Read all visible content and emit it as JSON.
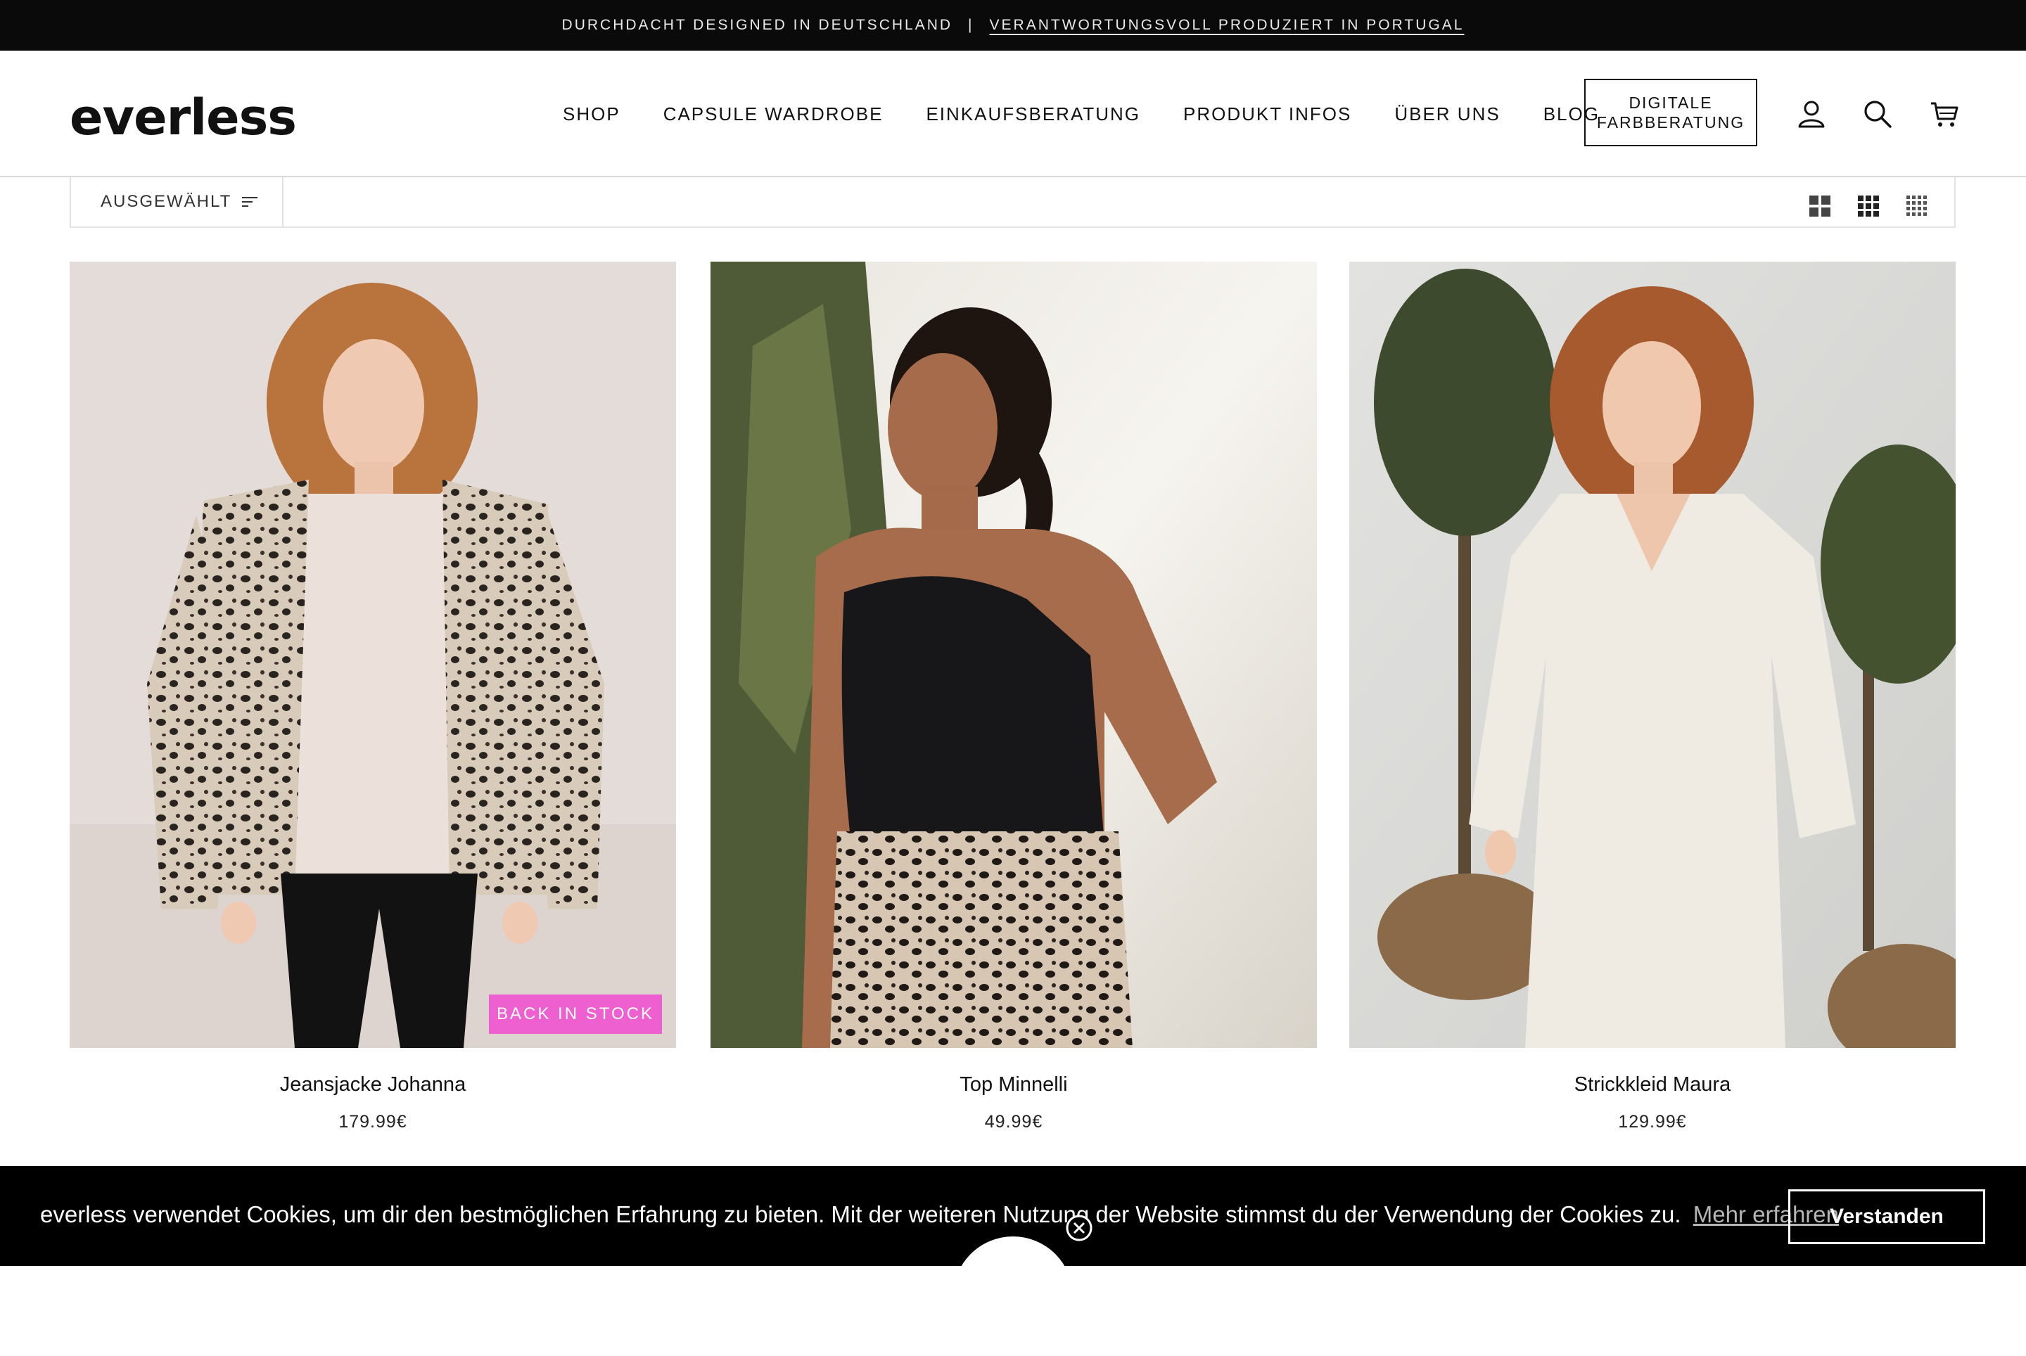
{
  "announcement": {
    "left": "DURCHDACHT DESIGNED IN DEUTSCHLAND",
    "separator": "|",
    "right": "VERANTWORTUNGSVOLL PRODUZIERT IN PORTUGAL"
  },
  "header": {
    "logo": "everless",
    "nav": [
      "SHOP",
      "CAPSULE WARDROBE",
      "EINKAUFSBERATUNG",
      "PRODUKT INFOS",
      "ÜBER UNS",
      "BLOG"
    ],
    "cta_line1": "DIGITALE",
    "cta_line2": "FARBBERATUNG",
    "icons": [
      "account-icon",
      "search-icon",
      "cart-icon"
    ]
  },
  "toolbar": {
    "sort_label": "AUSGEWÄHLT",
    "grid_options": [
      "grid-large-icon",
      "grid-medium-icon",
      "grid-small-icon"
    ]
  },
  "products": [
    {
      "title": "Jeansjacke Johanna",
      "price": "179.99€",
      "badge": "BACK IN STOCK"
    },
    {
      "title": "Top Minnelli",
      "price": "49.99€"
    },
    {
      "title": "Strickkleid Maura",
      "price": "129.99€"
    }
  ],
  "cookie": {
    "message": "everless verwendet Cookies, um dir den bestmöglichen Erfahrung zu bieten. Mit der weiteren Nutzung der Website stimmst du der Verwendung der Cookies zu.",
    "more_link": "Mehr erfahren",
    "accept_button": "Verstanden"
  },
  "colors": {
    "badge": "#ee5fd0",
    "announcement_bg": "#0a0a0a",
    "cookie_bg": "#000000"
  }
}
